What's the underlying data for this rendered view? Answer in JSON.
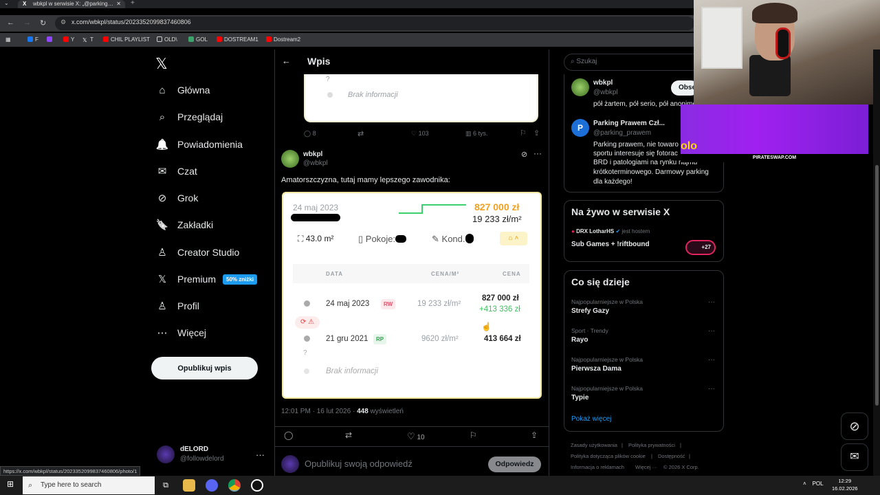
{
  "browser": {
    "tab_title": "wbkpl w serwisie X: „@parking…",
    "url": "x.com/wbkpl/status/2023352099837460806",
    "bookmarks": [
      {
        "label": "F",
        "color": "#1877f2"
      },
      {
        "label": "",
        "color": "#9146ff"
      },
      {
        "label": "Y",
        "color": "#ff0000"
      },
      {
        "label": "T",
        "color": "#ffffff"
      },
      {
        "label": "CHIL PLAYLIST",
        "color": "#ff0000"
      },
      {
        "label": "OLD\\",
        "color": "#888888"
      },
      {
        "label": "GOL",
        "color": "#3ca36b"
      },
      {
        "label": "DOSTREAM1",
        "color": "#ff0000"
      },
      {
        "label": "Dostream2",
        "color": "#ff0000"
      }
    ],
    "status_url": "https://x.com/wbkpl/status/2023352099837460806/photo/1"
  },
  "nav": {
    "logo": "𝕏",
    "items": [
      {
        "label": "Główna",
        "icon": "⌂"
      },
      {
        "label": "Przeglądaj",
        "icon": "⌕"
      },
      {
        "label": "Powiadomienia",
        "icon": "🔔"
      },
      {
        "label": "Czat",
        "icon": "✉"
      },
      {
        "label": "Grok",
        "icon": "⊘"
      },
      {
        "label": "Zakładki",
        "icon": "🔖"
      },
      {
        "label": "Creator Studio",
        "icon": "♙"
      },
      {
        "label": "Premium",
        "icon": "𝕏"
      },
      {
        "label": "Profil",
        "icon": "♙"
      },
      {
        "label": "Więcej",
        "icon": "⋯"
      }
    ],
    "premium_badge": "50% zniżki",
    "post_button": "Opublikuj wpis",
    "user_name": "dELORD",
    "user_handle": "@followdelord"
  },
  "main": {
    "header_title": "Wpis",
    "prev_card_q": "?",
    "prev_card_text": "Brak informacji",
    "prev_actions": {
      "replies": "8",
      "likes": "103",
      "views": "6 tys."
    },
    "tweet": {
      "name": "wbkpl",
      "handle": "@wbkpl",
      "text": "Amatorszczyzna, tutaj mamy lepszego zawodnika:",
      "meta_time": "12:01 PM · 16 lut 2026 · ",
      "meta_views": "448",
      "meta_views_label": " wyświetleń",
      "likes": "10"
    },
    "reply_placeholder": "Opublikuj swoją odpowiedź",
    "reply_button": "Odpowiedz"
  },
  "listing": {
    "date": "24 maj 2023",
    "price": "827 000 zł",
    "price_sqm": "19 233 zł/m²",
    "area": "43.0 m²",
    "rooms_label": "Pokoje:",
    "condition_label": "Kond.",
    "columns": [
      "DATA",
      "CENA/M²",
      "CENA"
    ],
    "rows": [
      {
        "date": "24 maj 2023",
        "tag": "RW",
        "tag_color": "#e0506a",
        "tag_bg": "#fde8ec",
        "sqm": "19 233 zł/m²",
        "price": "827 000 zł",
        "diff": "+413 336 zł"
      },
      {
        "date": "21 gru 2021",
        "tag": "RP",
        "tag_color": "#30a050",
        "tag_bg": "#e6f6ea",
        "sqm": "9620 zł/m²",
        "price": "413 664 zł",
        "diff": ""
      }
    ],
    "q_mark": "?",
    "no_info": "Brak informacji"
  },
  "right": {
    "search_placeholder": "Szukaj",
    "follow_button": "Obse",
    "who": [
      {
        "name": "wbkpl",
        "handle": "@wbkpl",
        "bio": "pół żartem, pół serio, pół anonimowo"
      },
      {
        "name": "Parking Prawem Czł...",
        "handle": "@parking_prawem",
        "bio_lines": [
          "Parking prawem, nie towaro",
          "sportu interesuje się fotorac",
          "BRD i patologiami na rynku najmu",
          "krótkoterminowego. Darmowy parking",
          "dla każdego!"
        ]
      }
    ],
    "live_title": "Na żywo w serwisie X",
    "live_host": "DRX LotharHS",
    "live_host_suffix": " jest hostem",
    "live_stream": "Sub Games + !riftbound",
    "live_count": "+27",
    "trends_title": "Co się dzieje",
    "trends": [
      {
        "category": "Najpopularniejsze w Polska",
        "name": "Strefy Gazy"
      },
      {
        "category": "Sport · Trendy",
        "name": "Rayo"
      },
      {
        "category": "Najpopularniejsze w Polska",
        "name": "Pierwsza Dama"
      },
      {
        "category": "Najpopularniejsze w Polska",
        "name": "Typie"
      }
    ],
    "show_more": "Pokaż więcej",
    "footer": [
      "Zasady użytkowania",
      "|",
      "Polityka prywatności",
      "|",
      "Polityka dotycząca plików cookie",
      "|",
      "Dostępność",
      "|",
      "Informacja o reklamach",
      "Więcej ···",
      "© 2026 X Corp."
    ]
  },
  "overlay": {
    "promo_label": "PIRATESWAP.COM",
    "promo_text": "olo"
  },
  "taskbar": {
    "search_placeholder": "Type here to search",
    "lang": "POL",
    "time": "12:29",
    "date": "16.02.2026"
  }
}
